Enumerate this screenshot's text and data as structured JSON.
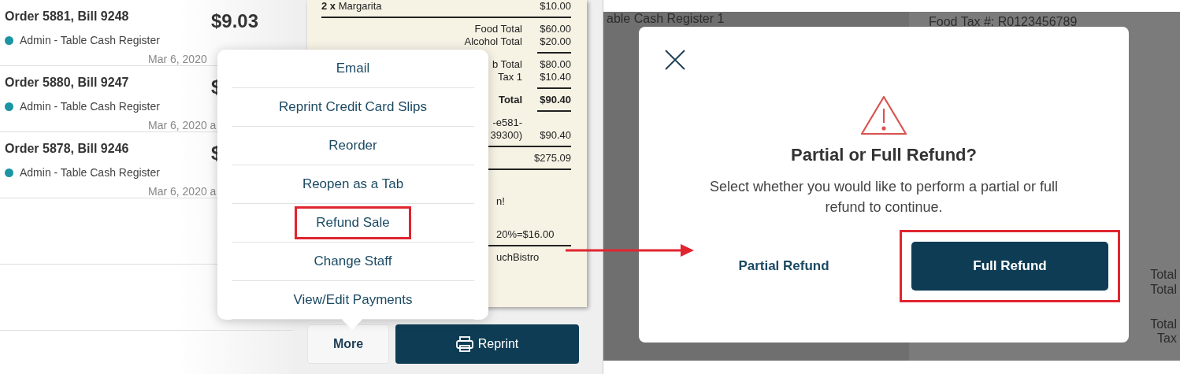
{
  "orders": [
    {
      "title": "Order 5881, Bill 9248",
      "staff": "Admin - Table Cash Register",
      "amount": "$9.03",
      "date": "Mar 6, 2020"
    },
    {
      "title": "Order 5880, Bill 9247",
      "staff": "Admin - Table Cash Register",
      "amount": "$",
      "date": "Mar 6, 2020 a"
    },
    {
      "title": "Order 5878, Bill 9246",
      "staff": "Admin - Table Cash Register",
      "amount": "$",
      "date": "Mar 6, 2020 a"
    }
  ],
  "receipt": {
    "rows": [
      {
        "kind": "item",
        "label": "**2 x** Margarita",
        "value": "$10.00"
      },
      {
        "kind": "rule"
      },
      {
        "kind": "total",
        "label": "Food Total",
        "value": "$60.00"
      },
      {
        "kind": "total",
        "label": "Alcohol Total",
        "value": "$20.00"
      },
      {
        "kind": "short_rule"
      },
      {
        "kind": "total",
        "label": "b Total",
        "value": "$80.00"
      },
      {
        "kind": "total",
        "label": "Tax 1",
        "value": "$10.40"
      },
      {
        "kind": "short_rule"
      },
      {
        "kind": "grand",
        "label": "Total",
        "value": "$90.40"
      },
      {
        "kind": "short_rule"
      },
      {
        "kind": "total",
        "label": "-e581-",
        "value": ""
      },
      {
        "kind": "total",
        "label": "39300)",
        "value": "$90.40"
      },
      {
        "kind": "rule"
      },
      {
        "kind": "total",
        "label": "",
        "value": "$275.09"
      },
      {
        "kind": "rule"
      },
      {
        "kind": "gap"
      },
      {
        "kind": "note",
        "label": "n!"
      },
      {
        "kind": "gap"
      },
      {
        "kind": "note",
        "label": "20%=$16.00"
      },
      {
        "kind": "rule"
      },
      {
        "kind": "note",
        "label": "uchBistro"
      }
    ]
  },
  "more_menu": {
    "items": [
      {
        "label": "Email",
        "highlighted": false
      },
      {
        "label": "Reprint Credit Card Slips",
        "highlighted": false
      },
      {
        "label": "Reorder",
        "highlighted": false
      },
      {
        "label": "Reopen as a Tab",
        "highlighted": false
      },
      {
        "label": "Refund Sale",
        "highlighted": true
      },
      {
        "label": "Change Staff",
        "highlighted": false
      },
      {
        "label": "View/Edit Payments",
        "highlighted": false
      }
    ]
  },
  "footer_buttons": {
    "more": "More",
    "reprint": "Reprint"
  },
  "background": {
    "top_left": "able Cash Register 1",
    "top_right": "Food Tax #: R0123456789",
    "right_edge": [
      "Total",
      "Total",
      "Total",
      "Tax"
    ]
  },
  "dialog": {
    "title": "Partial or Full Refund?",
    "message": "Select whether you would like to perform a partial or full refund to continue.",
    "buttons": [
      {
        "kind": "link",
        "label": "Partial Refund",
        "highlighted": false
      },
      {
        "kind": "primary",
        "label": "Full Refund",
        "highlighted": true
      }
    ]
  }
}
